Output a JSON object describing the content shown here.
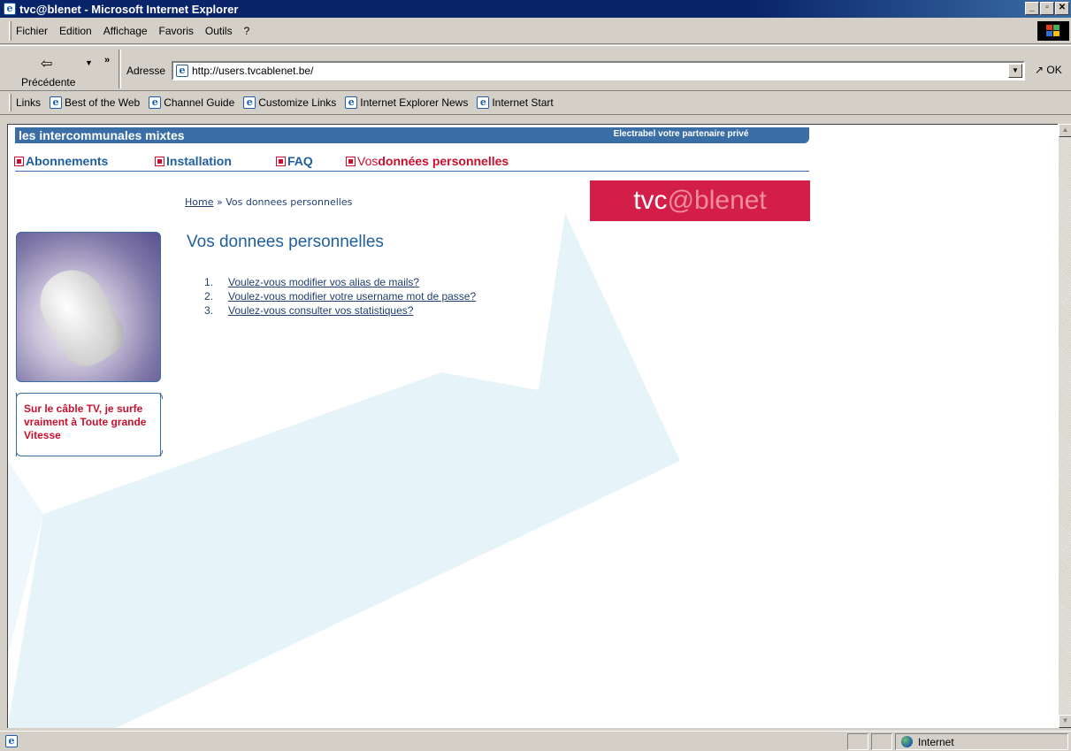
{
  "window": {
    "title": "tvc@blenet - Microsoft Internet Explorer",
    "controls": [
      "_",
      "▫",
      "✕"
    ]
  },
  "menu": [
    "Fichier",
    "Edition",
    "Affichage",
    "Favoris",
    "Outils",
    "?"
  ],
  "toolbar": {
    "back_label": "Précédente",
    "address_label": "Adresse",
    "url": "http://users.tvcablenet.be/",
    "go_label": "OK"
  },
  "links_bar": {
    "label": "Links",
    "items": [
      "Best of the Web",
      "Channel Guide",
      "Customize Links",
      "Internet Explorer News",
      "Internet Start"
    ]
  },
  "page": {
    "banner_left": "les intercommunales mixtes",
    "banner_right": "Electrabel votre partenaire privé",
    "nav": [
      {
        "label": "Abonnements"
      },
      {
        "label": "Installation"
      },
      {
        "label": "FAQ"
      },
      {
        "label_prefix": "Vos ",
        "label_bold": "données personnelles"
      }
    ],
    "breadcrumb_home": "Home",
    "breadcrumb_sep": " » ",
    "breadcrumb_current": "Vos donnees personnelles",
    "logo_part1": "tvc",
    "logo_part2": "@ble",
    "logo_part3": "net",
    "title": "Vos donnees personnelles",
    "links": [
      {
        "num": "1.",
        "text": "Voulez-vous modifier vos alias de mails?"
      },
      {
        "num": "2.",
        "text": "Voulez-vous modifier votre username mot de passe?"
      },
      {
        "num": "3.",
        "text": "Voulez-vous consulter vos statistiques?"
      }
    ],
    "tagline": "Sur le câble TV, je surfe vraiment à Toute grande Vitesse"
  },
  "status": {
    "zone": "Internet"
  },
  "colors": {
    "accent_blue": "#3a6ea5",
    "link_blue": "#1f5fa0",
    "brand_red": "#d41e4a",
    "shape_cyan": "#e3f2f8"
  }
}
